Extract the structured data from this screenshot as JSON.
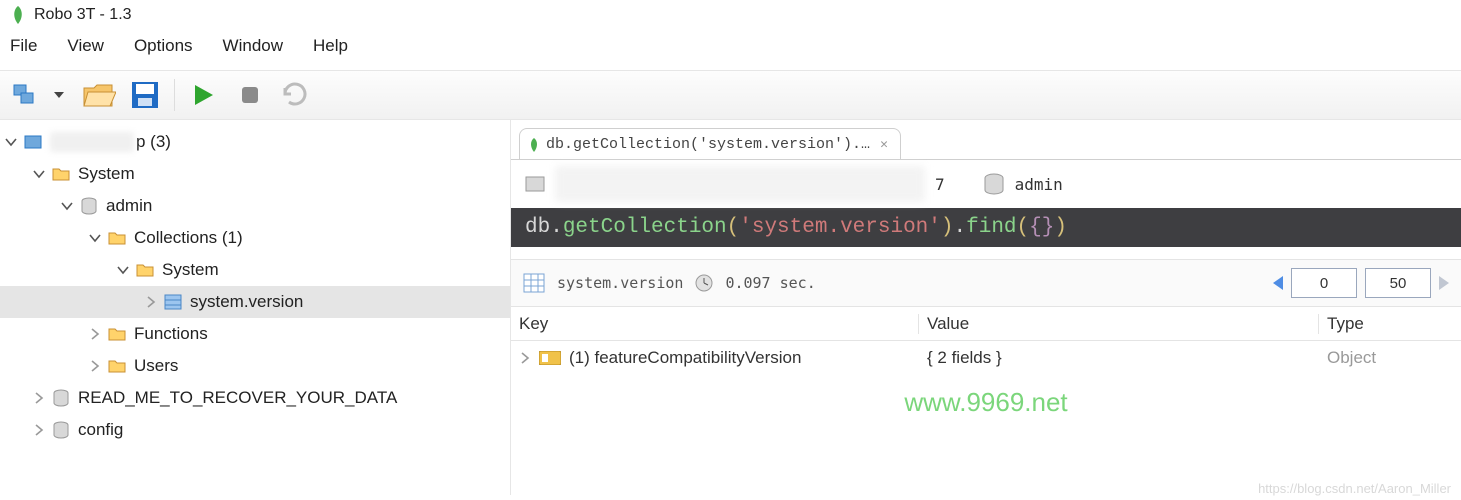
{
  "app": {
    "title": "Robo 3T - 1.3"
  },
  "menu": [
    "File",
    "View",
    "Options",
    "Window",
    "Help"
  ],
  "sidebar": {
    "root": {
      "label": "p (3)"
    },
    "system": {
      "label": "System"
    },
    "admin": {
      "label": "admin"
    },
    "collections": {
      "label": "Collections (1)"
    },
    "systemNode": {
      "label": "System"
    },
    "sysversion": {
      "label": "system.version"
    },
    "functions": {
      "label": "Functions"
    },
    "users": {
      "label": "Users"
    },
    "readme": {
      "label": "READ_ME_TO_RECOVER_YOUR_DATA"
    },
    "config": {
      "label": "config"
    }
  },
  "tab": {
    "label": "db.getCollection('system.version').…",
    "close": "✕"
  },
  "context": {
    "port": "7",
    "db": "admin"
  },
  "query": {
    "prefix": "db.",
    "fn1": "getCollection",
    "lp1": "(",
    "arg": "'system.version'",
    "rp1": ")",
    "dot": ".",
    "fn2": "find",
    "lp2": "(",
    "brace": "{}",
    "rp2": ")"
  },
  "result": {
    "collection": "system.version",
    "time": "0.097 sec.",
    "offset": "0",
    "limit": "50"
  },
  "grid": {
    "headers": {
      "key": "Key",
      "value": "Value",
      "type": "Type"
    },
    "row": {
      "key": "(1) featureCompatibilityVersion",
      "value": "{ 2 fields }",
      "type": "Object"
    }
  },
  "watermark": "www.9969.net",
  "footer_wm": "https://blog.csdn.net/Aaron_Miller"
}
